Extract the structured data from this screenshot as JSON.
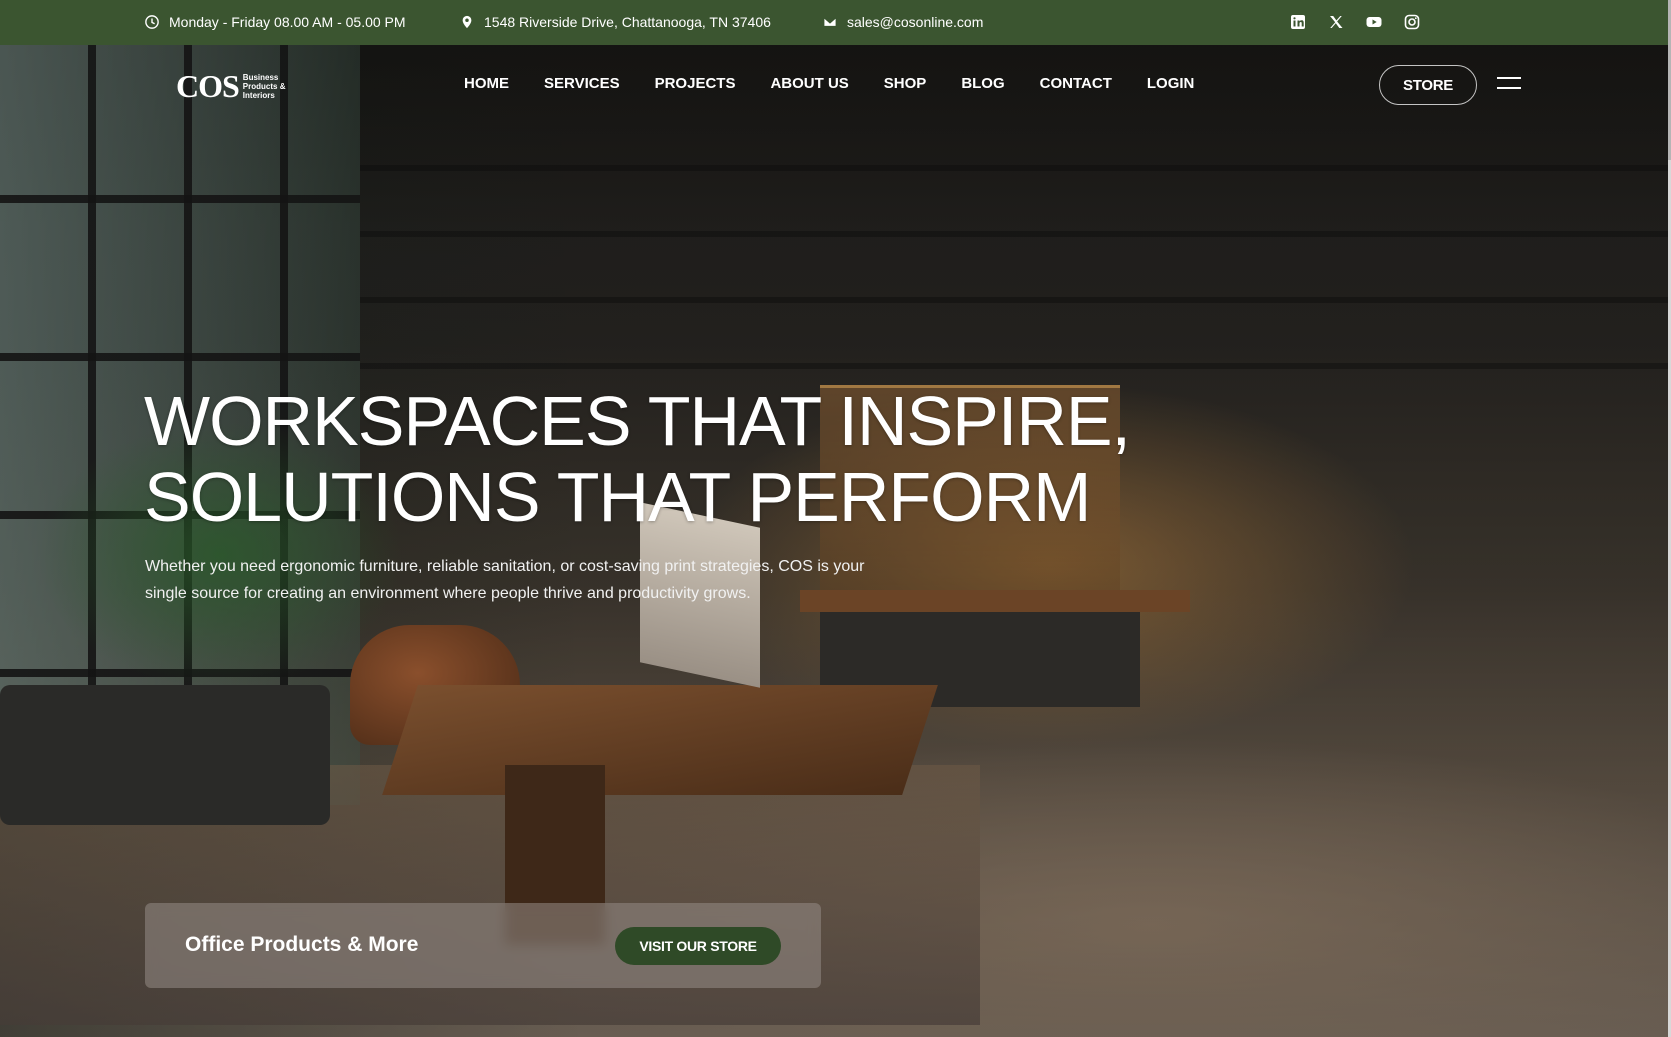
{
  "topbar": {
    "hours": "Monday - Friday 08.00 AM - 05.00 PM",
    "address": "1548 Riverside Drive, Chattanooga, TN 37406",
    "email": "sales@cosonline.com",
    "social": [
      "linkedin-icon",
      "x-icon",
      "youtube-icon",
      "instagram-icon"
    ]
  },
  "logo": {
    "wordmark": "COS",
    "tagline": "Business Products & Interiors"
  },
  "nav": {
    "items": [
      "HOME",
      "SERVICES",
      "PROJECTS",
      "ABOUT US",
      "SHOP",
      "BLOG",
      "CONTACT",
      "LOGIN"
    ],
    "store_label": "STORE"
  },
  "hero": {
    "headline_line1": "WORKSPACES THAT INSPIRE,",
    "headline_line2": "SOLUTIONS THAT PERFORM",
    "subtext": "Whether you need ergonomic furniture, reliable sanitation, or cost-saving print strategies, COS is your single source for creating an environment where people thrive and productivity grows."
  },
  "card": {
    "title": "Office Products & More",
    "cta_label": "VISIT OUR STORE"
  },
  "colors": {
    "brand_green": "#3b5530",
    "cta_green": "#2f4a27"
  }
}
